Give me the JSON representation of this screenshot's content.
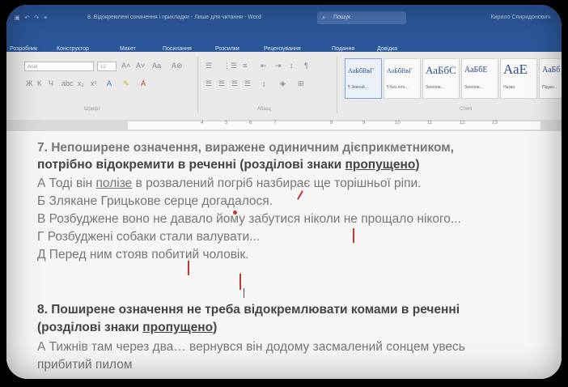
{
  "window": {
    "title": "8. Відокремлені означення і прикладки - Лише для читання - Word",
    "search_placeholder": "Пошук",
    "user": "Кирило Спиридонович"
  },
  "ribbon_tabs": [
    "Розробник",
    "Конструктор",
    "Макет",
    "Посилання",
    "Розсилки",
    "Рецензування",
    "Подання",
    "Довідка"
  ],
  "ribbon": {
    "font_name": "Arial",
    "font_size": "12",
    "group_font": "Шрифт",
    "group_paragraph": "Абзац",
    "group_styles": "Стилі",
    "styles": [
      {
        "preview": "АаБбВвГ",
        "name": "¶ Звичай..."
      },
      {
        "preview": "АаБбВвГ",
        "name": "¶ Без інте..."
      },
      {
        "preview": "АаБбС",
        "name": "Заголов..."
      },
      {
        "preview": "АаБбЕ",
        "name": "Заголов..."
      },
      {
        "preview": "АаЕ",
        "name": "Назва"
      },
      {
        "preview": "АаБб",
        "name": "Підзаг..."
      }
    ]
  },
  "document": {
    "q7_title_l1": "7. Непоширене означення, виражене одиничним дієприкметником,",
    "q7_title_l2a": "потрібно відокремити в реченні (розділові знаки ",
    "q7_title_l2b": "пропущено",
    "q7_title_l2c": ")",
    "q7_a_pre": "А Тоді він ",
    "q7_a_u": "полізе",
    "q7_a_post": " в розвалений погріб назбирає ще торішньої ріпи.",
    "q7_b": "Б Злякане Грицькове серце догадалося.",
    "q7_c": "В Розбуджене воно не давало йому забутися ніколи не прощало нікого...",
    "q7_d": "Г Розбуджені собаки стали валувати...",
    "q7_e": "Д Перед ним стояв побитий чоловік.",
    "q8_title_l1": "8. Поширене означення не треба відокремлювати комами в реченні",
    "q8_title_l2a": "(розділові знаки ",
    "q8_title_l2b": "пропущено",
    "q8_title_l2c": ")",
    "q8_a": "А Тижнів там через два… вернувся він додому засмалений сонцем увесь",
    "q8_a_cont": "прибитий пилом"
  },
  "colors": {
    "titlebar": "#2b579a",
    "pen_mark": "#c0392b"
  }
}
